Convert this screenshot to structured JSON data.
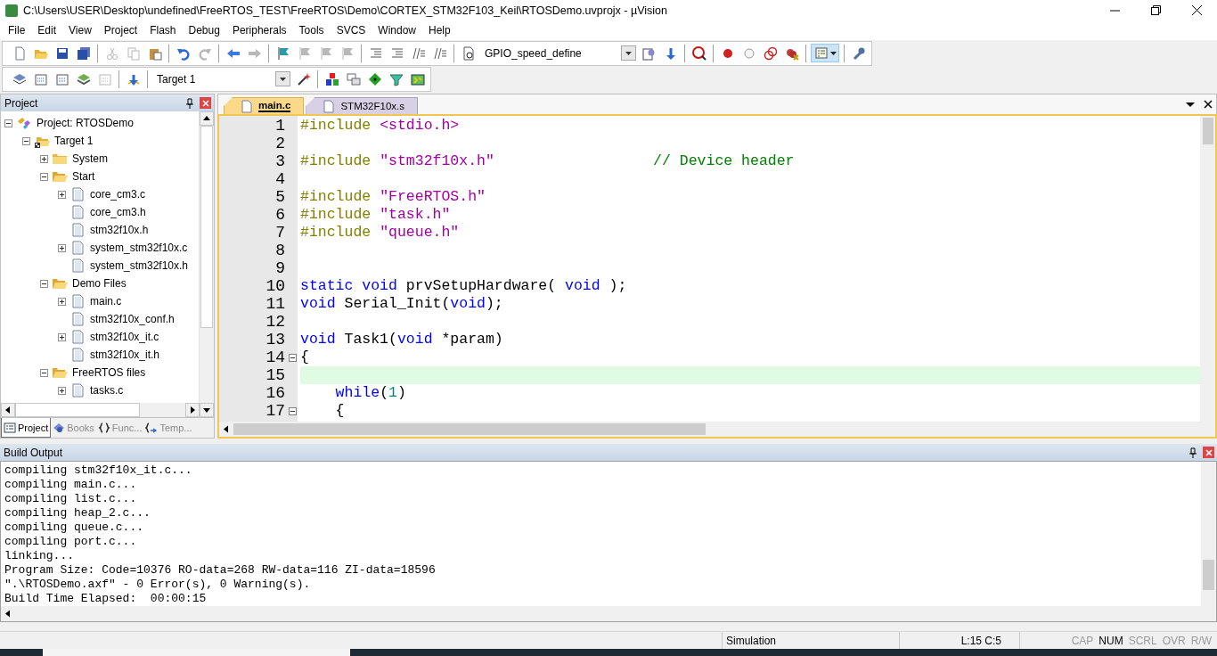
{
  "window": {
    "title": "C:\\Users\\USER\\Desktop\\undefined\\FreeRTOS_TEST\\FreeRTOS\\Demo\\CORTEX_STM32F103_Keil\\RTOSDemo.uvprojx - µVision"
  },
  "menu": [
    "File",
    "Edit",
    "View",
    "Project",
    "Flash",
    "Debug",
    "Peripherals",
    "Tools",
    "SVCS",
    "Window",
    "Help"
  ],
  "toolbars": [
    {
      "items": [
        {
          "kind": "new",
          "disabled": false
        },
        {
          "kind": "open",
          "disabled": false
        },
        {
          "kind": "save",
          "disabled": false
        },
        {
          "kind": "saveall",
          "disabled": false
        },
        {
          "kind": "separator"
        },
        {
          "kind": "cut",
          "disabled": true
        },
        {
          "kind": "copy",
          "disabled": true
        },
        {
          "kind": "paste",
          "disabled": false
        },
        {
          "kind": "separator"
        },
        {
          "kind": "undo",
          "disabled": false
        },
        {
          "kind": "redo",
          "disabled": true
        },
        {
          "kind": "separator"
        },
        {
          "kind": "back",
          "disabled": false
        },
        {
          "kind": "forward",
          "disabled": true
        },
        {
          "kind": "separator"
        },
        {
          "kind": "bookmark",
          "disabled": false
        },
        {
          "kind": "bookmark",
          "disabled": true
        },
        {
          "kind": "bookmark",
          "disabled": true
        },
        {
          "kind": "bookmark",
          "disabled": true
        },
        {
          "kind": "separator"
        },
        {
          "kind": "indent",
          "disabled": false
        },
        {
          "kind": "indent",
          "disabled": false
        },
        {
          "kind": "comment",
          "disabled": false
        },
        {
          "kind": "comment",
          "disabled": false
        },
        {
          "kind": "separator"
        },
        {
          "kind": "findfile",
          "disabled": false
        },
        {
          "kind": "combo",
          "value": "GPIO_speed_define"
        },
        {
          "kind": "find",
          "disabled": false
        },
        {
          "kind": "findref",
          "disabled": false
        },
        {
          "kind": "separator"
        },
        {
          "kind": "debug",
          "disabled": false
        },
        {
          "kind": "separator"
        },
        {
          "kind": "breakpoint",
          "disabled": false
        },
        {
          "kind": "bpdisable",
          "disabled": false
        },
        {
          "kind": "bpdisableall",
          "disabled": false
        },
        {
          "kind": "bpkill",
          "disabled": false
        },
        {
          "kind": "separator"
        },
        {
          "kind": "windows",
          "disabled": false,
          "pressed": true
        },
        {
          "kind": "separator"
        },
        {
          "kind": "config",
          "disabled": false
        }
      ]
    },
    {
      "items": [
        {
          "kind": "translate",
          "disabled": false
        },
        {
          "kind": "build",
          "disabled": false
        },
        {
          "kind": "build",
          "disabled": false
        },
        {
          "kind": "batch",
          "disabled": false
        },
        {
          "kind": "build",
          "disabled": true
        },
        {
          "kind": "separator"
        },
        {
          "kind": "download",
          "disabled": false
        },
        {
          "kind": "separator"
        },
        {
          "kind": "combo",
          "value": "Target 1"
        },
        {
          "kind": "options",
          "disabled": false
        },
        {
          "kind": "separator"
        },
        {
          "kind": "manage",
          "disabled": false
        },
        {
          "kind": "windows2",
          "disabled": false
        },
        {
          "kind": "diamond",
          "disabled": false
        },
        {
          "kind": "funnel",
          "disabled": false
        },
        {
          "kind": "packs",
          "disabled": false
        }
      ]
    }
  ],
  "project_pane": {
    "title": "Project",
    "tree": [
      {
        "label": "Project: RTOSDemo",
        "kind": "project",
        "expanded": true,
        "children": [
          {
            "label": "Target 1",
            "kind": "target",
            "expanded": true,
            "children": [
              {
                "label": "System",
                "kind": "folder",
                "expanded": false
              },
              {
                "label": "Start",
                "kind": "folder",
                "expanded": true,
                "children": [
                  {
                    "label": "core_cm3.c",
                    "kind": "file",
                    "expanded": false
                  },
                  {
                    "label": "core_cm3.h",
                    "kind": "file"
                  },
                  {
                    "label": "stm32f10x.h",
                    "kind": "file"
                  },
                  {
                    "label": "system_stm32f10x.c",
                    "kind": "file",
                    "expanded": false
                  },
                  {
                    "label": "system_stm32f10x.h",
                    "kind": "file"
                  }
                ]
              },
              {
                "label": "Demo Files",
                "kind": "folder",
                "expanded": true,
                "children": [
                  {
                    "label": "main.c",
                    "kind": "file",
                    "expanded": false
                  },
                  {
                    "label": "stm32f10x_conf.h",
                    "kind": "file"
                  },
                  {
                    "label": "stm32f10x_it.c",
                    "kind": "file",
                    "expanded": false
                  },
                  {
                    "label": "stm32f10x_it.h",
                    "kind": "file"
                  }
                ]
              },
              {
                "label": "FreeRTOS files",
                "kind": "folder",
                "expanded": true,
                "children": [
                  {
                    "label": "tasks.c",
                    "kind": "file",
                    "expanded": false
                  }
                ]
              }
            ]
          }
        ]
      }
    ],
    "tabs": [
      {
        "label": "Project",
        "selected": true
      },
      {
        "label": "Books",
        "selected": false
      },
      {
        "label": "Func...",
        "selected": false
      },
      {
        "label": "Temp...",
        "selected": false
      }
    ]
  },
  "editor": {
    "tabs": [
      {
        "label": "main.c",
        "selected": true
      },
      {
        "label": "STM32F10x.s",
        "selected": false
      }
    ],
    "lines": [
      {
        "number": "1",
        "current": false,
        "tokens": [
          {
            "kind": "preproc",
            "text": "#include "
          },
          {
            "kind": "string",
            "text": "<stdio.h>"
          }
        ]
      },
      {
        "number": "2",
        "current": false
      },
      {
        "number": "3",
        "current": false,
        "tokens": [
          {
            "kind": "preproc",
            "text": "#include "
          },
          {
            "kind": "string",
            "text": "\"stm32f10x.h\""
          },
          {
            "kind": "trailing_comment",
            "text": "// Device header"
          }
        ]
      },
      {
        "number": "4",
        "current": false
      },
      {
        "number": "5",
        "current": false,
        "tokens": [
          {
            "kind": "preproc",
            "text": "#include "
          },
          {
            "kind": "string",
            "text": "\"FreeRTOS.h\""
          }
        ]
      },
      {
        "number": "6",
        "current": false,
        "tokens": [
          {
            "kind": "preproc",
            "text": "#include "
          },
          {
            "kind": "string",
            "text": "\"task.h\""
          }
        ]
      },
      {
        "number": "7",
        "current": false,
        "tokens": [
          {
            "kind": "preproc",
            "text": "#include "
          },
          {
            "kind": "string",
            "text": "\"queue.h\""
          }
        ]
      },
      {
        "number": "8",
        "current": false
      },
      {
        "number": "9",
        "current": false
      },
      {
        "number": "10",
        "current": false,
        "tokens": [
          {
            "kind": "keyword",
            "text": "static void"
          },
          {
            "kind": "plain",
            "text": " prvSetupHardware( "
          },
          {
            "kind": "keyword",
            "text": "void"
          },
          {
            "kind": "plain",
            "text": " );"
          }
        ]
      },
      {
        "number": "11",
        "current": false,
        "tokens": [
          {
            "kind": "keyword",
            "text": "void"
          },
          {
            "kind": "plain",
            "text": " Serial_Init("
          },
          {
            "kind": "keyword",
            "text": "void"
          },
          {
            "kind": "plain",
            "text": ");"
          }
        ]
      },
      {
        "number": "12",
        "current": false
      },
      {
        "number": "13",
        "current": false,
        "tokens": [
          {
            "kind": "keyword",
            "text": "void"
          },
          {
            "kind": "plain",
            "text": " Task1("
          },
          {
            "kind": "keyword",
            "text": "void"
          },
          {
            "kind": "plain",
            "text": " *param)"
          }
        ]
      },
      {
        "number": "14",
        "current": false,
        "fold": true,
        "tokens": [
          {
            "kind": "plain",
            "text": "{"
          }
        ]
      },
      {
        "number": "15",
        "current": true
      },
      {
        "number": "16",
        "current": false,
        "tokens": [
          {
            "kind": "keyword",
            "text": "    while"
          },
          {
            "kind": "plain",
            "text": "("
          },
          {
            "kind": "number",
            "text": "1"
          },
          {
            "kind": "plain",
            "text": ")"
          }
        ]
      },
      {
        "number": "17",
        "current": false,
        "fold": true,
        "tokens": [
          {
            "kind": "plain",
            "text": "    {"
          }
        ]
      }
    ]
  },
  "build_output": {
    "title": "Build Output",
    "lines": [
      "compiling stm32f10x_it.c...",
      "compiling main.c...",
      "compiling list.c...",
      "compiling heap_2.c...",
      "compiling queue.c...",
      "compiling port.c...",
      "linking...",
      "Program Size: Code=10376 RO-data=268 RW-data=116 ZI-data=18596",
      "\".\\RTOSDemo.axf\" - 0 Error(s), 0 Warning(s).",
      "Build Time Elapsed:  00:00:15"
    ]
  },
  "status_bar": {
    "mode": "Simulation",
    "position": "L:15 C:5",
    "indicators": [
      {
        "label": "CAP",
        "on": false
      },
      {
        "label": "NUM",
        "on": true
      },
      {
        "label": "SCRL",
        "on": false
      },
      {
        "label": "OVR",
        "on": false
      },
      {
        "label": "R/W",
        "on": false
      }
    ]
  }
}
